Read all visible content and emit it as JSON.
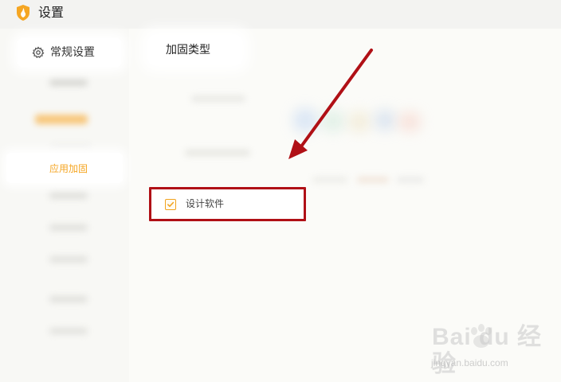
{
  "window": {
    "title": "设置",
    "logo_icon": "app-shield-icon"
  },
  "sidebar": {
    "general": {
      "label": "常规设置",
      "icon": "gear-icon"
    },
    "app_harden": {
      "label": "应用加固",
      "active_color": "#f5a623"
    }
  },
  "main": {
    "tab": {
      "label": "加固类型"
    },
    "option": {
      "label": "设计软件",
      "checked": true
    }
  },
  "annotation": {
    "arrow_color": "#b01016",
    "highlight_color": "#b01016"
  },
  "watermark": {
    "logo_text": "Bai du 经验",
    "url_text": "jingyan.baidu.com"
  }
}
